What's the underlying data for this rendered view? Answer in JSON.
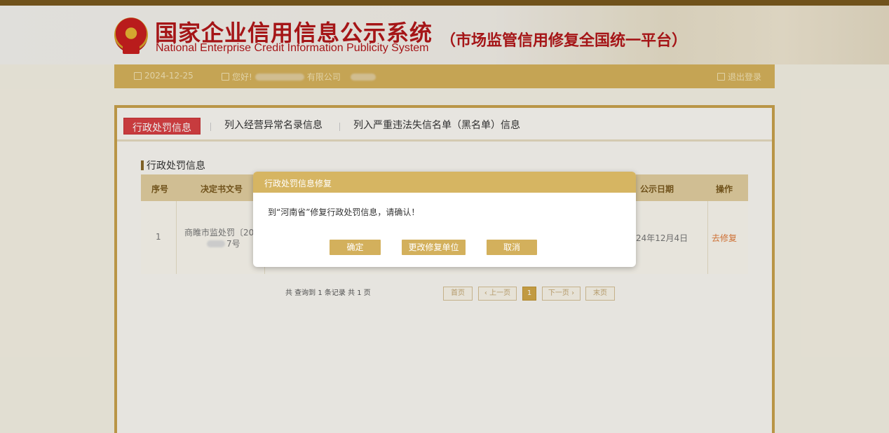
{
  "header": {
    "title_cn": "国家企业信用信息公示系统",
    "title_en": "National Enterprise Credit Information Publicity System",
    "subtitle": "（市场监管信用修复全国统一平台）"
  },
  "infobar": {
    "date": "2024-12-25",
    "greeting_prefix": "您好!",
    "company_suffix": "有限公司",
    "logout": "退出登录"
  },
  "tabs": [
    {
      "label": "行政处罚信息"
    },
    {
      "label": "列入经营异常名录信息"
    },
    {
      "label": "列入严重违法失信名单（黑名单）信息"
    }
  ],
  "section": {
    "title": "行政处罚信息"
  },
  "table": {
    "columns": [
      "序号",
      "决定书文号",
      "公示日期",
      "操作"
    ],
    "rows": [
      {
        "index": "1",
        "doc_no_line1": "商睢市监处罚〔20",
        "doc_no_line2": "7号",
        "date": "24年12月4日",
        "action": "去修复"
      }
    ]
  },
  "pagination": {
    "summary": "共 查询到 1 条记录 共 1 页",
    "first": "首页",
    "prev": "‹ 上一页",
    "current": "1",
    "next": "下一页 ›",
    "last": "末页"
  },
  "dialog": {
    "title": "行政处罚信息修复",
    "message": "到“河南省”修复行政处罚信息，请确认！",
    "confirm": "确定",
    "change_unit": "更改修复单位",
    "cancel": "取消"
  },
  "colors": {
    "brand_red": "#b3171a",
    "gold": "#d6b25c",
    "active_tab": "#d84044"
  }
}
